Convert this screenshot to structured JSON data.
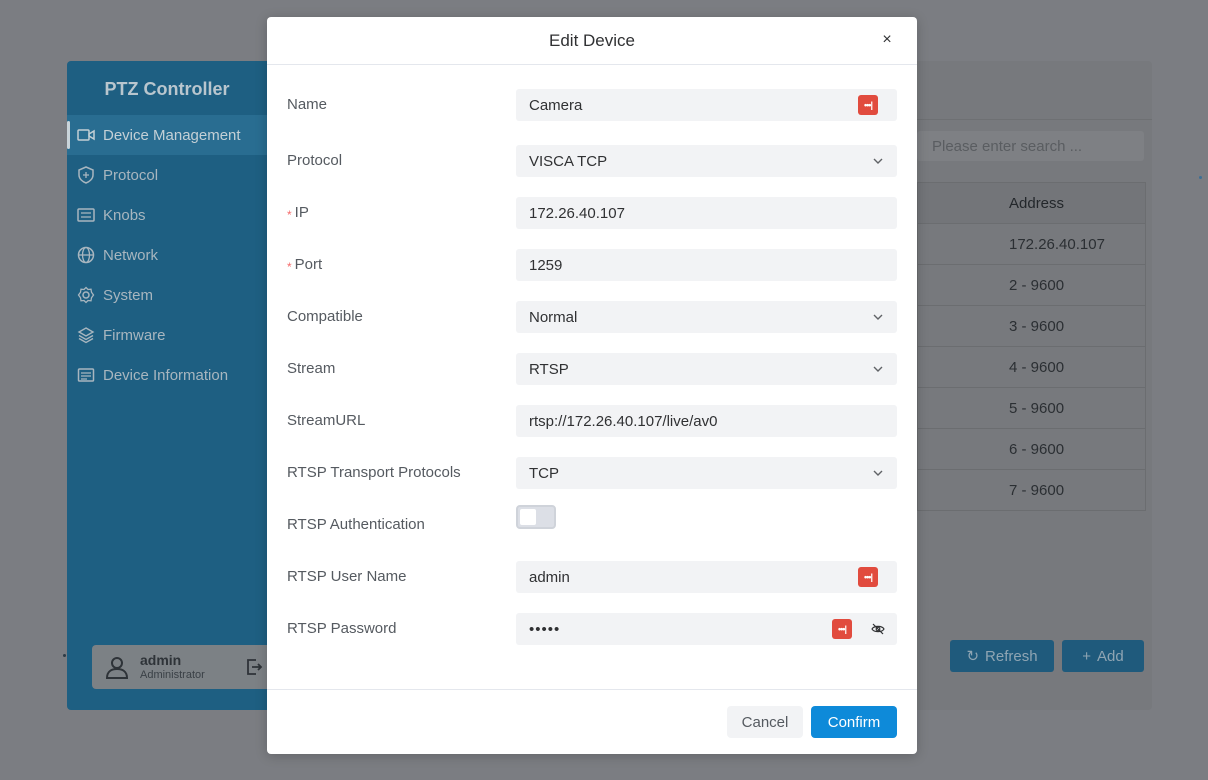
{
  "app": {
    "brand": "PTZ Controller",
    "nav": [
      {
        "label": "Device Management",
        "icon": "camera-icon",
        "active": true
      },
      {
        "label": "Protocol",
        "icon": "shield-icon"
      },
      {
        "label": "Knobs",
        "icon": "keyboard-icon"
      },
      {
        "label": "Network",
        "icon": "globe-icon"
      },
      {
        "label": "System",
        "icon": "gear-icon"
      },
      {
        "label": "Firmware",
        "icon": "layers-icon"
      },
      {
        "label": "Device Information",
        "icon": "card-icon"
      }
    ],
    "user": {
      "name": "admin",
      "role": "Administrator"
    },
    "search_placeholder": "Please enter search ...",
    "table": {
      "header": "Address",
      "rows": [
        "172.26.40.107",
        "2 - 9600",
        "3 - 9600",
        "4 - 9600",
        "5 - 9600",
        "6 - 9600",
        "7 - 9600"
      ]
    },
    "refresh_label": "Refresh",
    "add_label": "Add",
    "accent_color": "#0e8ad9"
  },
  "modal": {
    "title": "Edit Device",
    "close": "×",
    "fields": {
      "name": {
        "label": "Name",
        "value": "Camera"
      },
      "protocol": {
        "label": "Protocol",
        "value": "VISCA TCP"
      },
      "ip": {
        "label": "IP",
        "value": "172.26.40.107",
        "required": true
      },
      "port": {
        "label": "Port",
        "value": "1259",
        "required": true
      },
      "compatible": {
        "label": "Compatible",
        "value": "Normal"
      },
      "stream": {
        "label": "Stream",
        "value": "RTSP"
      },
      "stream_url": {
        "label": "StreamURL",
        "value": "rtsp://172.26.40.107/live/av0"
      },
      "rtsp_transport": {
        "label": "RTSP Transport Protocols",
        "value": "TCP"
      },
      "rtsp_auth": {
        "label": "RTSP Authentication",
        "enabled": false
      },
      "rtsp_user": {
        "label": "RTSP User Name",
        "value": "admin"
      },
      "rtsp_password": {
        "label": "RTSP Password",
        "value": "•••••"
      }
    },
    "required_mark": "*",
    "cancel_label": "Cancel",
    "confirm_label": "Confirm"
  }
}
